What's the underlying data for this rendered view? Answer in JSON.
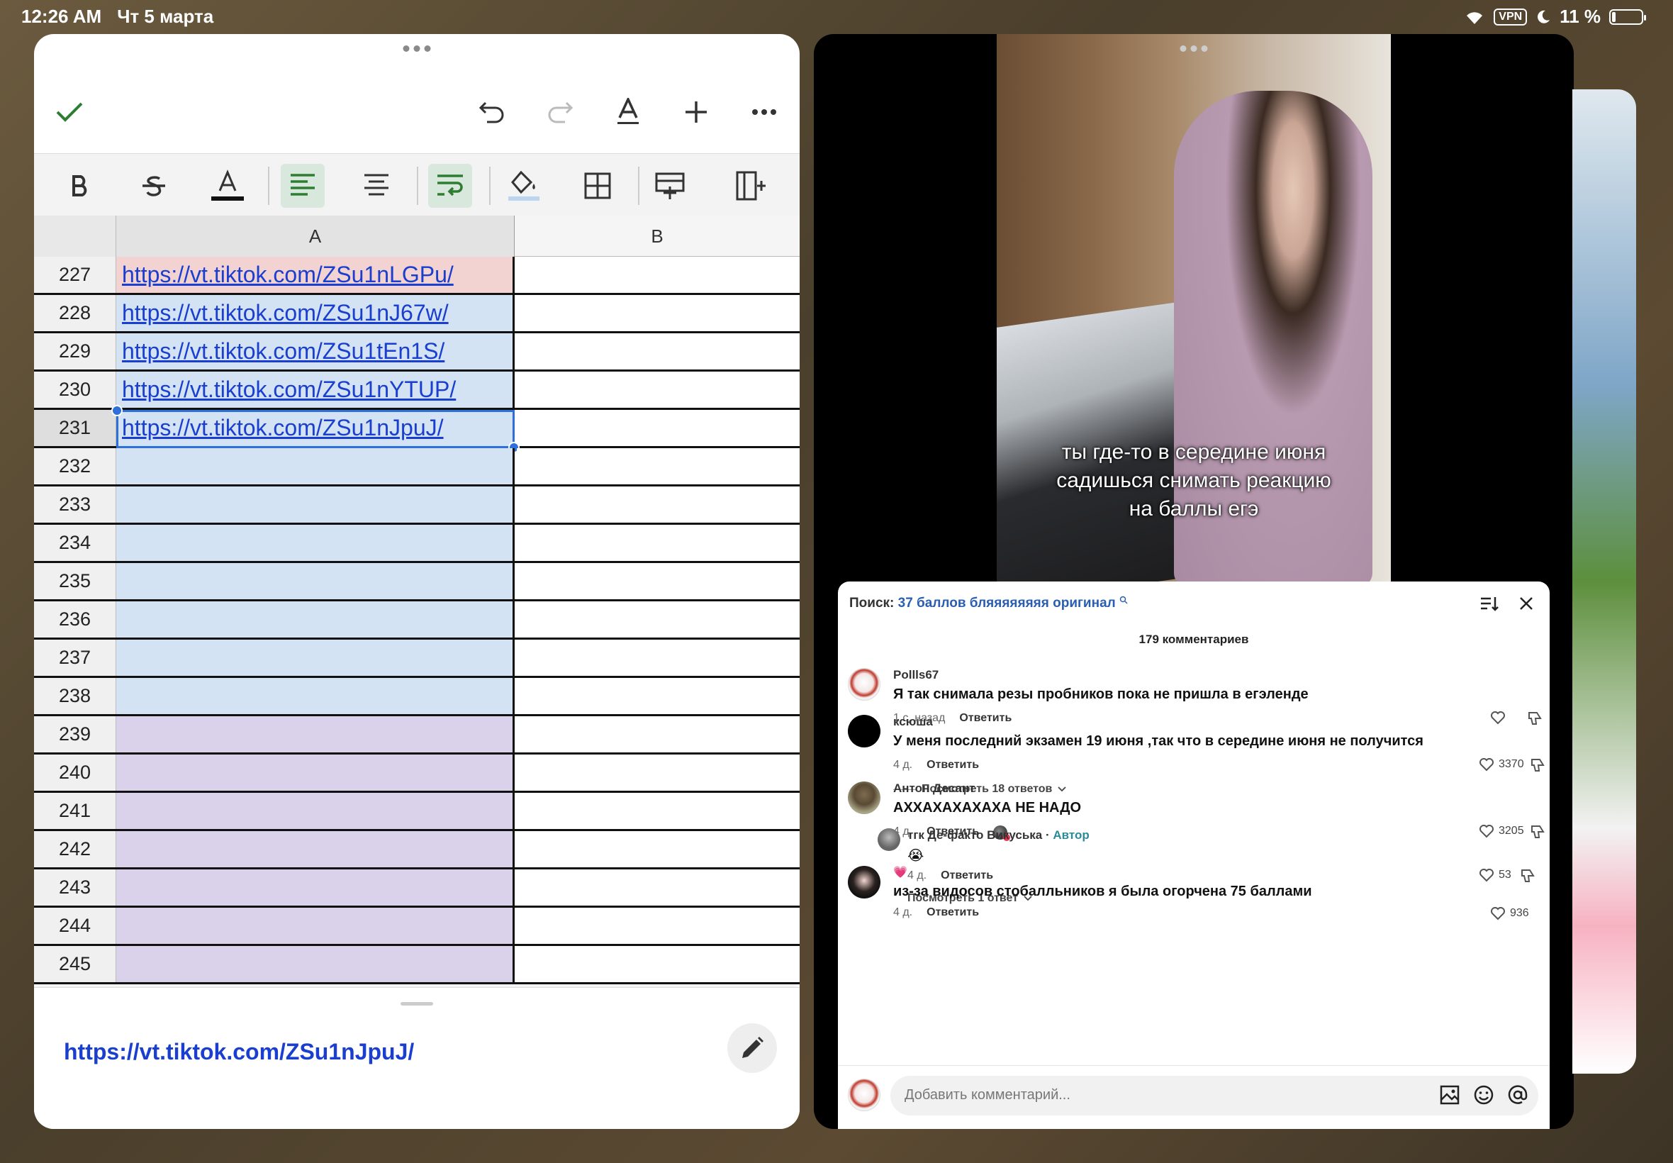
{
  "status_bar": {
    "time": "12:26 AM",
    "date": "Чт 5 марта",
    "vpn": "VPN",
    "battery": "11 %",
    "battery_level": 0.11
  },
  "spreadsheet": {
    "columns": [
      "A",
      "B"
    ],
    "rows": [
      {
        "num": "227",
        "a": "https://vt.tiktok.com/ZSu1nLGPu/",
        "color": "#f3d2d2"
      },
      {
        "num": "228",
        "a": "https://vt.tiktok.com/ZSu1nJ67w/",
        "color": "#d3e3f3"
      },
      {
        "num": "229",
        "a": "https://vt.tiktok.com/ZSu1tEn1S/",
        "color": "#d3e3f3"
      },
      {
        "num": "230",
        "a": "https://vt.tiktok.com/ZSu1nYTUP/",
        "color": "#d3e3f3"
      },
      {
        "num": "231",
        "a": "https://vt.tiktok.com/ZSu1nJpuJ/",
        "color": "#d3e3f3",
        "selected": true
      },
      {
        "num": "232",
        "a": "",
        "color": "#d3e3f3"
      },
      {
        "num": "233",
        "a": "",
        "color": "#d3e3f3"
      },
      {
        "num": "234",
        "a": "",
        "color": "#d3e3f3"
      },
      {
        "num": "235",
        "a": "",
        "color": "#d3e3f3"
      },
      {
        "num": "236",
        "a": "",
        "color": "#d3e3f3"
      },
      {
        "num": "237",
        "a": "",
        "color": "#d3e3f3"
      },
      {
        "num": "238",
        "a": "",
        "color": "#d3e3f3"
      },
      {
        "num": "239",
        "a": "",
        "color": "#d9d2ea"
      },
      {
        "num": "240",
        "a": "",
        "color": "#d9d2ea"
      },
      {
        "num": "241",
        "a": "",
        "color": "#d9d2ea"
      },
      {
        "num": "242",
        "a": "",
        "color": "#d9d2ea"
      },
      {
        "num": "243",
        "a": "",
        "color": "#d9d2ea"
      },
      {
        "num": "244",
        "a": "",
        "color": "#d9d2ea"
      },
      {
        "num": "245",
        "a": "",
        "color": "#d9d2ea"
      }
    ],
    "formula": "https://vt.tiktok.com/ZSu1nJpuJ/",
    "colors": {
      "accent_green": "#2e7d32",
      "link": "#1a3fcf",
      "selection": "#2e6fd9"
    }
  },
  "video": {
    "caption_lines": [
      "ты где-то в середине июня",
      "садишься снимать реакцию",
      "на баллы егэ"
    ]
  },
  "comments": {
    "search_label": "Поиск:",
    "search_query": "37 баллов бляяяяяяяя оригинал",
    "count": "179 комментариев",
    "input_placeholder": "Добавить комментарий...",
    "items": [
      {
        "user": "Pollls67",
        "text": "Я так снимала резы пробников пока не пришла в егэленде",
        "time": "1 с. назад",
        "reply": "Ответить",
        "likes": ""
      },
      {
        "user": "ксюша",
        "text": "У меня последний экзамен 19 июня ,так что в середине июня не получится",
        "time": "4 д.",
        "reply": "Ответить",
        "likes": "3370",
        "view_replies": "Посмотреть 18 ответов"
      },
      {
        "user": "Антон Десант",
        "text": "АХХАХАХАХАХА НЕ НАДО",
        "time": "4 д.",
        "reply": "Ответить",
        "likes": "3205"
      },
      {
        "user": "тгк Де-факто Викуська",
        "author_sep": "·",
        "author": "Автор",
        "text": "😭",
        "time": "4 д.",
        "reply": "Ответить",
        "likes": "53",
        "view_replies": "Посмотреть 1 ответ"
      },
      {
        "user": "💗",
        "text": "из-за видосов стобалльников я была огорчена 75 баллами",
        "time": "4 д.",
        "reply": "Ответить",
        "likes": "936"
      }
    ]
  }
}
